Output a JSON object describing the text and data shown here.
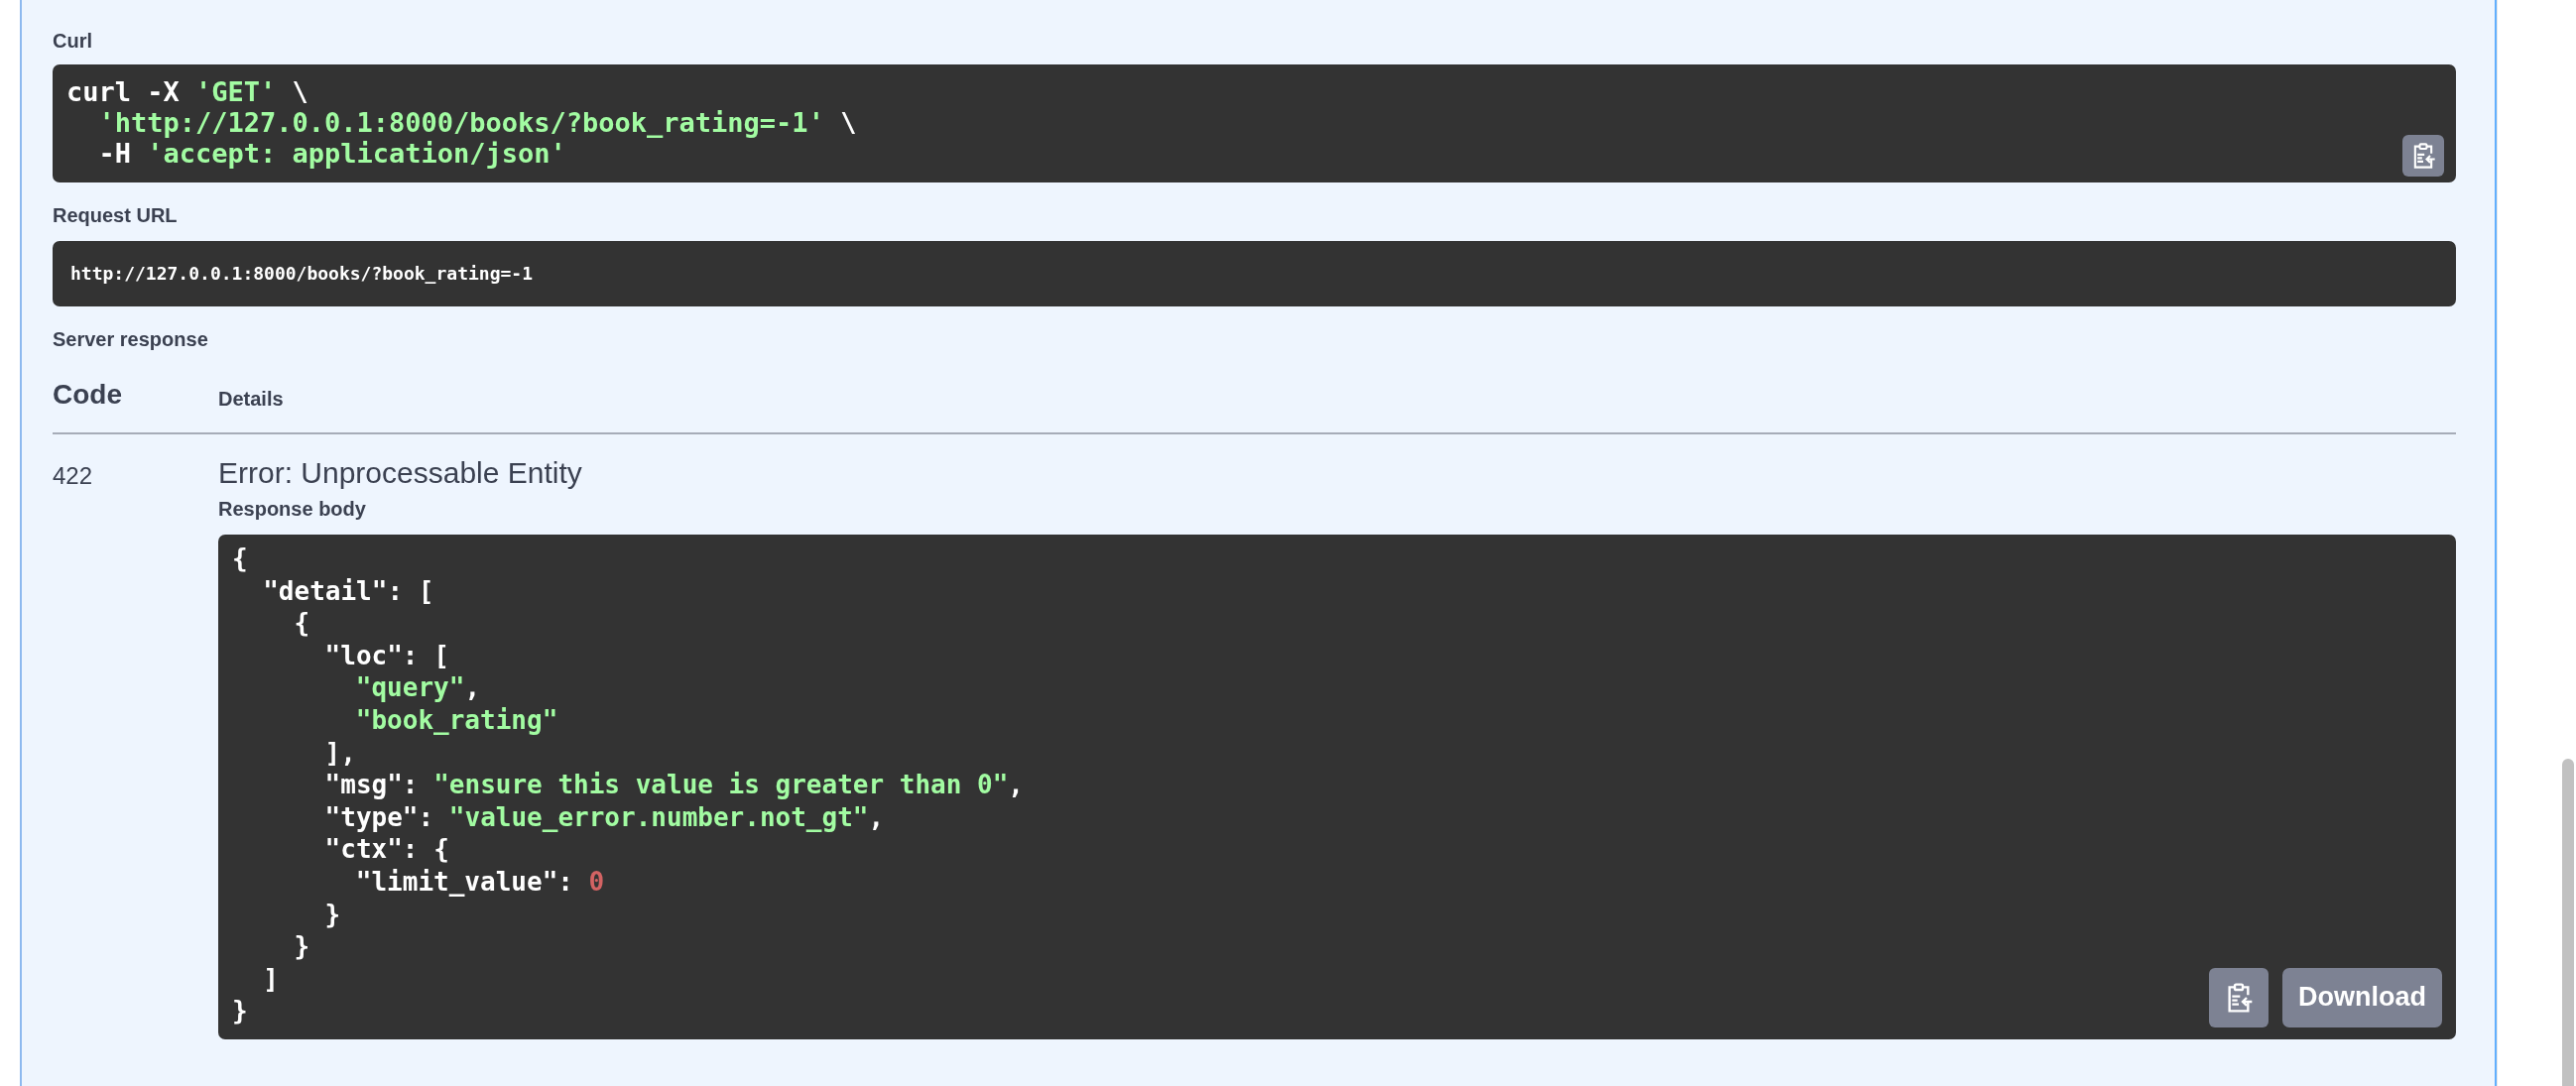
{
  "curl": {
    "label": "Curl",
    "lines": [
      [
        {
          "kind": "plain",
          "text": "curl -X "
        },
        {
          "kind": "string",
          "text": "'GET'"
        },
        {
          "kind": "plain",
          "text": " \\"
        }
      ],
      [
        {
          "kind": "string",
          "text": "'http://127.0.0.1:8000/books/?book_rating=-1'"
        },
        {
          "kind": "plain",
          "text": " \\"
        }
      ],
      [
        {
          "kind": "plain",
          "text": "-H "
        },
        {
          "kind": "string",
          "text": "'accept: application/json'"
        }
      ]
    ]
  },
  "request_url": {
    "label": "Request URL",
    "value": "http://127.0.0.1:8000/books/?book_rating=-1"
  },
  "server_response": {
    "label": "Server response",
    "columns": [
      "Code",
      "Details"
    ],
    "code": "422",
    "status": "Error: Unprocessable Entity",
    "body_label": "Response body",
    "body_lines": [
      [
        {
          "kind": "plain",
          "text": "{"
        }
      ],
      [
        {
          "kind": "plain",
          "text": "\"detail\": ["
        }
      ],
      [
        {
          "kind": "plain",
          "text": "{"
        }
      ],
      [
        {
          "kind": "plain",
          "text": "\"loc\": ["
        }
      ],
      [
        {
          "kind": "string",
          "text": "\"query\""
        },
        {
          "kind": "plain",
          "text": ","
        }
      ],
      [
        {
          "kind": "string",
          "text": "\"book_rating\""
        }
      ],
      [
        {
          "kind": "plain",
          "text": "],"
        }
      ],
      [
        {
          "kind": "plain",
          "text": "\"msg\": "
        },
        {
          "kind": "string",
          "text": "\"ensure this value is greater than 0\""
        },
        {
          "kind": "plain",
          "text": ","
        }
      ],
      [
        {
          "kind": "plain",
          "text": "\"type\": "
        },
        {
          "kind": "string",
          "text": "\"value_error.number.not_gt\""
        },
        {
          "kind": "plain",
          "text": ","
        }
      ],
      [
        {
          "kind": "plain",
          "text": "\"ctx\": {"
        }
      ],
      [
        {
          "kind": "plain",
          "text": "\"limit_value\": "
        },
        {
          "kind": "number",
          "text": "0"
        }
      ],
      [
        {
          "kind": "plain",
          "text": "}"
        }
      ],
      [
        {
          "kind": "plain",
          "text": "}"
        }
      ],
      [
        {
          "kind": "plain",
          "text": "]"
        }
      ],
      [
        {
          "kind": "plain",
          "text": "}"
        }
      ]
    ],
    "download_label": "Download"
  }
}
